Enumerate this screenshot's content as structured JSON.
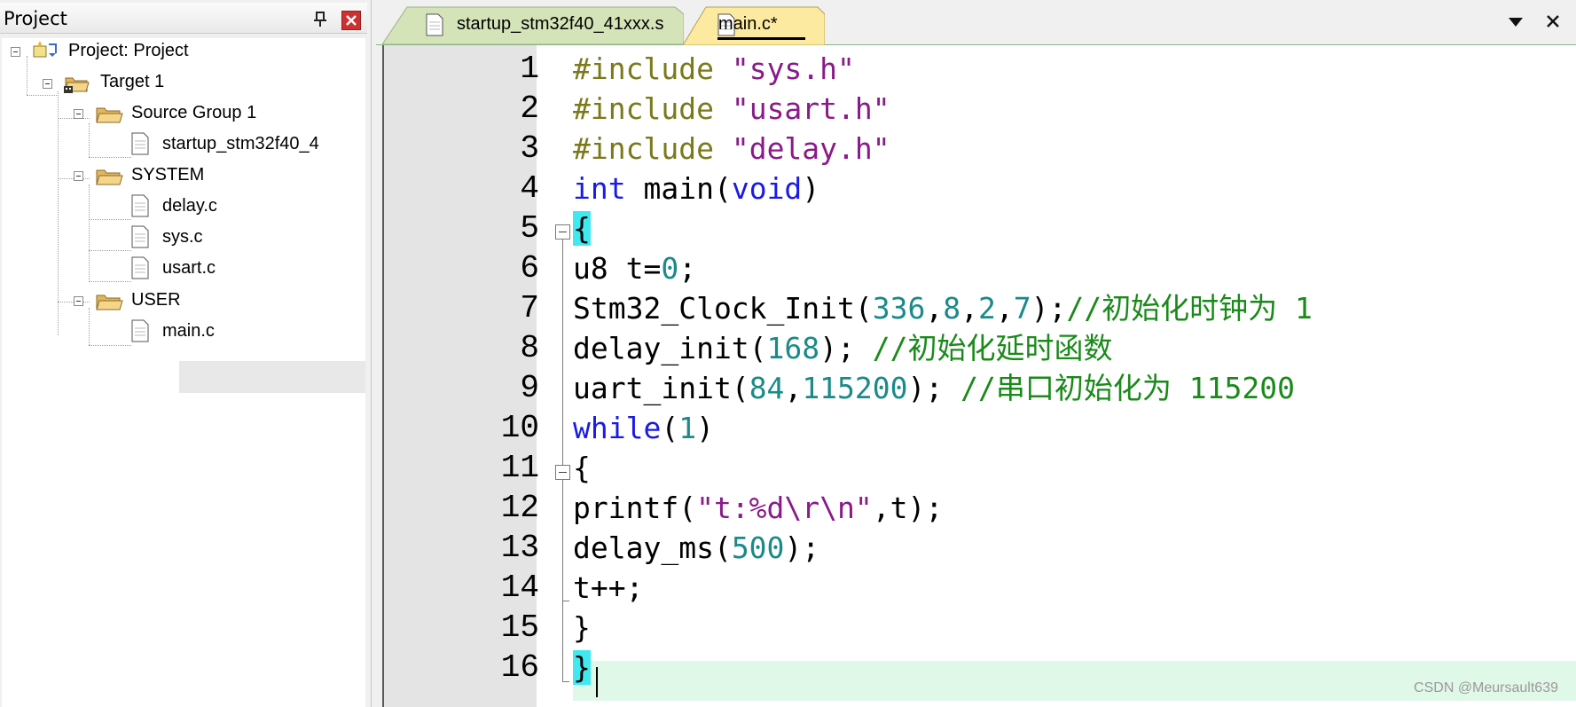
{
  "project_panel": {
    "title": "Project",
    "tree": {
      "root": "Project: Project",
      "target": "Target 1",
      "groups": [
        {
          "name": "Source Group 1",
          "files": [
            "startup_stm32f40_4"
          ]
        },
        {
          "name": "SYSTEM",
          "files": [
            "delay.c",
            "sys.c",
            "usart.c"
          ]
        },
        {
          "name": "USER",
          "files": [
            "main.c"
          ]
        }
      ],
      "selected_file": "main.c"
    }
  },
  "editor": {
    "tabs": [
      {
        "label": "startup_stm32f40_41xxx.s",
        "active": false
      },
      {
        "label": "main.c*",
        "active": true
      }
    ],
    "line_numbers": [
      "1",
      "2",
      "3",
      "4",
      "5",
      "6",
      "7",
      "8",
      "9",
      "10",
      "11",
      "12",
      "13",
      "14",
      "15",
      "16"
    ],
    "current_line": "16",
    "code": [
      [
        [
          "pre",
          "#include"
        ],
        [
          "plain",
          " "
        ],
        [
          "str",
          "\"sys.h\""
        ]
      ],
      [
        [
          "pre",
          "#include"
        ],
        [
          "plain",
          " "
        ],
        [
          "str",
          "\"usart.h\""
        ]
      ],
      [
        [
          "pre",
          "#include"
        ],
        [
          "plain",
          " "
        ],
        [
          "str",
          "\"delay.h\""
        ]
      ],
      [
        [
          "kw",
          "int"
        ],
        [
          "plain",
          " main("
        ],
        [
          "kw",
          "void"
        ],
        [
          "plain",
          ")"
        ]
      ],
      [
        [
          "brace",
          "{"
        ]
      ],
      [
        [
          "plain",
          "u8 t="
        ],
        [
          "num",
          "0"
        ],
        [
          "plain",
          ";"
        ]
      ],
      [
        [
          "plain",
          "Stm32_Clock_Init("
        ],
        [
          "num",
          "336"
        ],
        [
          "plain",
          ","
        ],
        [
          "num",
          "8"
        ],
        [
          "plain",
          ","
        ],
        [
          "num",
          "2"
        ],
        [
          "plain",
          ","
        ],
        [
          "num",
          "7"
        ],
        [
          "plain",
          ");"
        ],
        [
          "cmt",
          "//初始化时钟为 1"
        ]
      ],
      [
        [
          "plain",
          "delay_init("
        ],
        [
          "num",
          "168"
        ],
        [
          "plain",
          "); "
        ],
        [
          "cmt",
          "//初始化延时函数"
        ]
      ],
      [
        [
          "plain",
          "uart_init("
        ],
        [
          "num",
          "84"
        ],
        [
          "plain",
          ","
        ],
        [
          "num",
          "115200"
        ],
        [
          "plain",
          "); "
        ],
        [
          "cmt",
          "//串口初始化为 115200"
        ]
      ],
      [
        [
          "kw",
          "while"
        ],
        [
          "plain",
          "("
        ],
        [
          "num",
          "1"
        ],
        [
          "plain",
          ")"
        ]
      ],
      [
        [
          "plain",
          "{"
        ]
      ],
      [
        [
          "plain",
          "printf("
        ],
        [
          "str",
          "\"t:%d\\r\\n\""
        ],
        [
          "plain",
          ",t);"
        ]
      ],
      [
        [
          "plain",
          "delay_ms("
        ],
        [
          "num",
          "500"
        ],
        [
          "plain",
          ");"
        ]
      ],
      [
        [
          "plain",
          "t++;"
        ]
      ],
      [
        [
          "plain",
          "}"
        ]
      ],
      [
        [
          "brace",
          "}"
        ]
      ]
    ]
  },
  "watermark": "CSDN @Meursault639",
  "colors": {
    "preprocessor": "#7a7a1a",
    "string": "#8a1a8a",
    "keyword": "#1a1ae6",
    "number": "#1a8a8a",
    "comment": "#1a8a1a",
    "brace_highlight": "#40e8f0",
    "current_line": "#e0f8e8"
  },
  "icons": [
    "pin-icon",
    "close-icon",
    "project-icon",
    "target-icon",
    "folder-icon",
    "file-icon",
    "dropdown-icon"
  ]
}
